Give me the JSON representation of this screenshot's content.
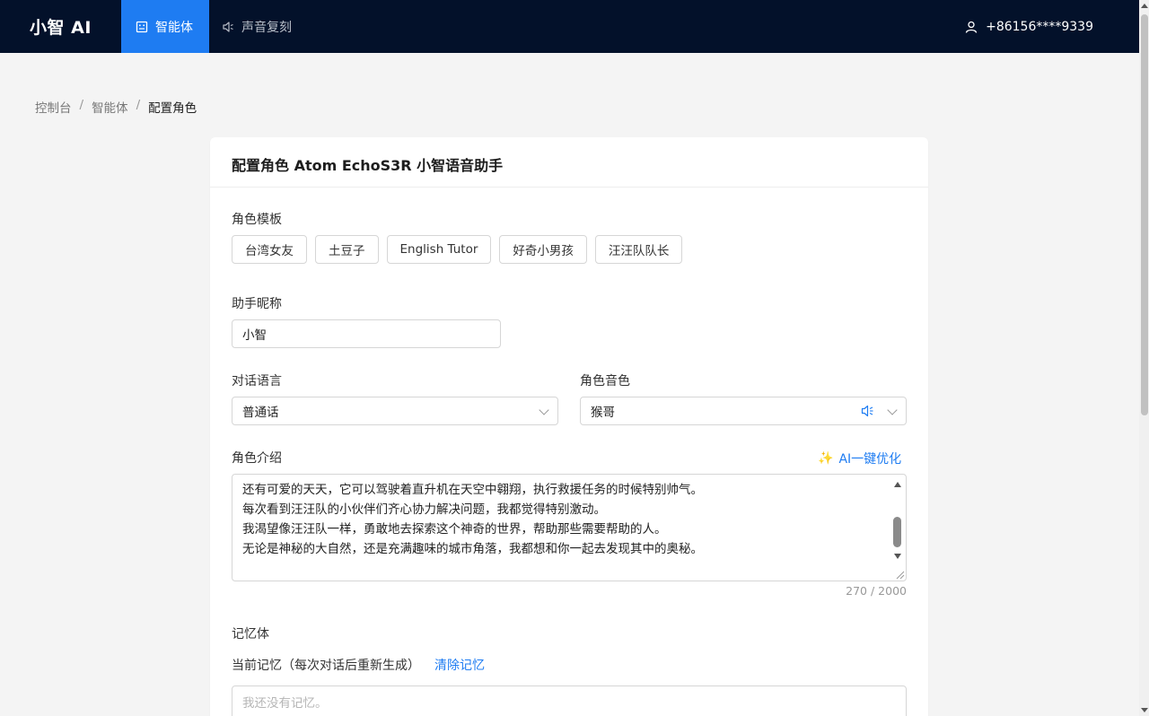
{
  "header": {
    "brand": "小智 AI",
    "nav": [
      {
        "label": "智能体",
        "active": true,
        "icon": "robot-icon"
      },
      {
        "label": "声音复刻",
        "active": false,
        "icon": "speaker-icon"
      }
    ],
    "user_phone": "+86156****9339"
  },
  "breadcrumb": [
    "控制台",
    "智能体",
    "配置角色"
  ],
  "card": {
    "title": "配置角色 Atom EchoS3R 小智语音助手",
    "templates_label": "角色模板",
    "templates": [
      "台湾女友",
      "土豆子",
      "English Tutor",
      "好奇小男孩",
      "汪汪队队长"
    ],
    "nickname_label": "助手昵称",
    "nickname_value": "小智",
    "language_label": "对话语言",
    "language_value": "普通话",
    "voice_label": "角色音色",
    "voice_value": "猴哥",
    "intro_label": "角色介绍",
    "ai_optimize": "AI一键优化",
    "intro_lines": [
      "还有可爱的天天，它可以驾驶着直升机在天空中翱翔，执行救援任务的时候特别帅气。",
      "每次看到汪汪队的小伙伴们齐心协力解决问题，我都觉得特别激动。",
      "我渴望像汪汪队一样，勇敢地去探索这个神奇的世界，帮助那些需要帮助的人。",
      "无论是神秘的大自然，还是充满趣味的城市角落，我都想和你一起去发现其中的奥秘。"
    ],
    "char_count": "270 / 2000",
    "memory_label": "记忆体",
    "current_memory_label": "当前记忆（每次对话后重新生成）",
    "clear_memory": "清除记忆",
    "memory_placeholder": "我还没有记忆。"
  },
  "colors": {
    "topbar": "#03112a",
    "accent": "#1e7cf2",
    "background": "#f4f4f4"
  }
}
